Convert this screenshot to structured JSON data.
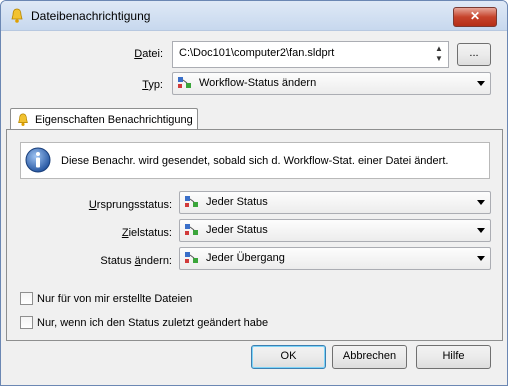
{
  "window": {
    "title": "Dateibenachrichtigung",
    "close_label": "✕"
  },
  "file": {
    "label_u": "D",
    "label_rest": "atei:",
    "value": "C:\\Doc101\\computer2\\fan.sldprt",
    "browse_label": "..."
  },
  "type": {
    "label_u": "T",
    "label_rest": "yp:",
    "value": "Workflow-Status ändern"
  },
  "tab": {
    "label": "Eigenschaften Benachrichtigung"
  },
  "info": {
    "text": "Diese Benachr. wird gesendet, sobald sich d. Workflow-Stat. einer Datei ändert."
  },
  "fields": {
    "source": {
      "label_u": "U",
      "label_rest": "rsprungsstatus:",
      "value": "Jeder Status"
    },
    "target": {
      "label_u": "Z",
      "label_rest": "ielstatus:",
      "value": "Jeder Status"
    },
    "change": {
      "label_pre": "Status ",
      "label_u": "ä",
      "label_rest": "ndern:",
      "value": "Jeder Übergang"
    }
  },
  "checkboxes": [
    {
      "label": "Nur für von mir erstellte Dateien",
      "checked": false
    },
    {
      "label": "Nur, wenn ich den Status zuletzt geändert habe",
      "checked": false
    }
  ],
  "buttons": {
    "ok": "OK",
    "cancel": "Abbrechen",
    "help": "Hilfe"
  }
}
